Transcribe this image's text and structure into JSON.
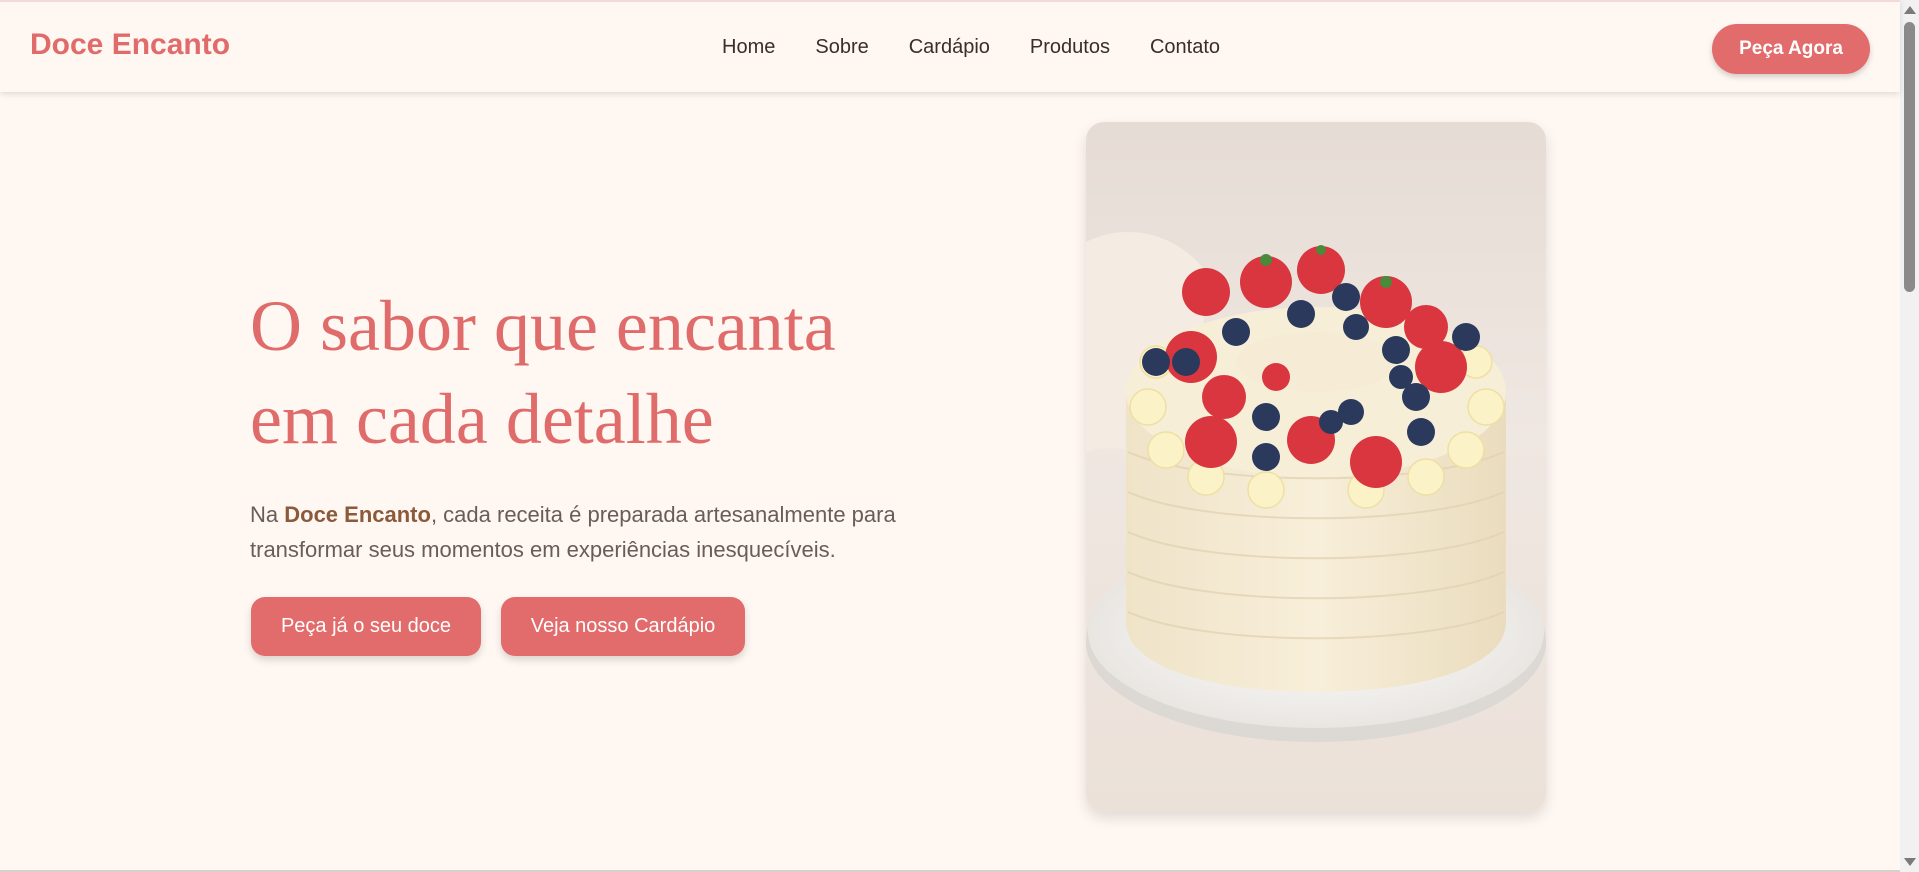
{
  "header": {
    "logo": "Doce Encanto",
    "nav": [
      "Home",
      "Sobre",
      "Cardápio",
      "Produtos",
      "Contato"
    ],
    "cta": "Peça Agora"
  },
  "hero": {
    "title_line1": "O sabor que encanta",
    "title_line2": "em cada detalhe",
    "text_prefix": "Na ",
    "text_brand": "Doce Encanto",
    "text_suffix": ", cada receita é preparada artesanalmente para transformar seus momentos em experiências inesquecíveis.",
    "button_order": "Peça já o seu doce",
    "button_menu": "Veja nosso Cardápio"
  },
  "colors": {
    "accent": "#e26b6c",
    "background": "#fff7f2",
    "brand_text": "#8a5a3a"
  },
  "image": {
    "icon": "cake-photo"
  }
}
